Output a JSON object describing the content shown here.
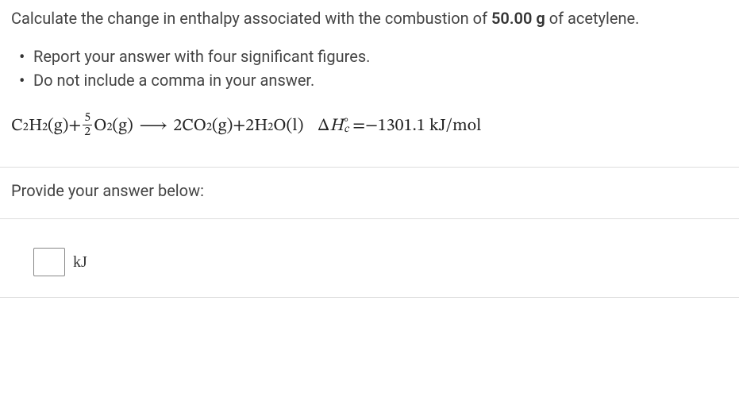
{
  "question": {
    "intro_before": "Calculate the change in enthalpy associated with the combustion of ",
    "intro_bold": "50.00 g",
    "intro_after": " of acetylene."
  },
  "instructions": [
    "Report your answer with four significant figures.",
    "Do not include a comma in your answer."
  ],
  "equation": {
    "r1_formula": "C",
    "r1_sub1": "2",
    "r1_formula2": "H",
    "r1_sub2": "2",
    "r1_phase": "(g)",
    "plus1": " + ",
    "frac_num": "5",
    "frac_den": "2",
    "r2_formula": "O",
    "r2_sub": "2",
    "r2_phase": "(g)",
    "arrow": "⟶",
    "p1_coef": "2",
    "p1_formula": " CO",
    "p1_sub": "2",
    "p1_phase": "(g)",
    "plus2": " + ",
    "p2_coef": "2",
    "p2_formula": " H",
    "p2_sub": "2",
    "p2_formula2": "O",
    "p2_phase": "(l)",
    "delta": "Δ",
    "H": "H",
    "sup_o": "∘",
    "sub_c": "c",
    "equals": " = ",
    "value": "−1301.1 kJ/mol"
  },
  "answer": {
    "prompt": "Provide your answer below:",
    "input_value": "",
    "unit": "kJ"
  }
}
